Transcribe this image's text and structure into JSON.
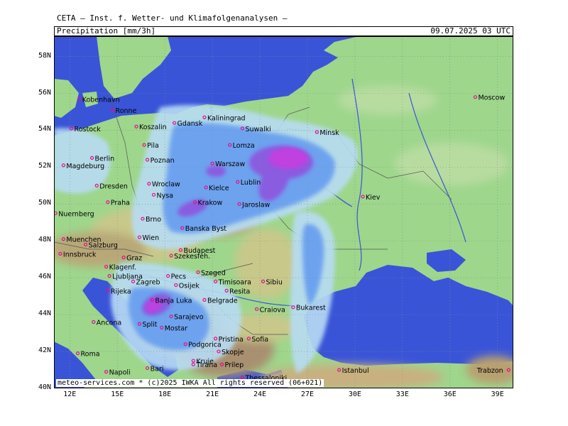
{
  "header": {
    "title": "CETA — Inst. f. Wetter- und Klimafolgenanalysen —",
    "product": "Precipitation [mm/3h]",
    "timestamp": "09.07.2025 03 UTC"
  },
  "credit": "meteo-services.com * (c)2025 IWKA All rights reserved (06+021)",
  "axes": {
    "lat_labels": [
      "58N",
      "56N",
      "54N",
      "52N",
      "50N",
      "48N",
      "46N",
      "44N",
      "42N",
      "40N"
    ],
    "lon_labels": [
      "12E",
      "15E",
      "18E",
      "21E",
      "24E",
      "27E",
      "30E",
      "33E",
      "36E",
      "39E"
    ]
  },
  "colors": {
    "sea": "#3a54d8",
    "lowland": "#9ed68c",
    "highland": "#c8c88a",
    "mountain": "#9c8a6a",
    "rain_light": "#b8dcf4",
    "rain_mid": "#6aa0f0",
    "rain_heavy": "#8a5ce0",
    "rain_extreme": "#c040e0",
    "city_marker": "#e01090",
    "grid": "#888888"
  },
  "cities": [
    {
      "name": "Kobenhavn",
      "lon": 12.6,
      "lat": 55.7
    },
    {
      "name": "Ronne",
      "lon": 14.7,
      "lat": 55.1
    },
    {
      "name": "Rostock",
      "lon": 12.1,
      "lat": 54.1
    },
    {
      "name": "Koszalin",
      "lon": 16.2,
      "lat": 54.2
    },
    {
      "name": "Gdansk",
      "lon": 18.6,
      "lat": 54.4
    },
    {
      "name": "Kaliningrad",
      "lon": 20.5,
      "lat": 54.7
    },
    {
      "name": "Suwalki",
      "lon": 22.9,
      "lat": 54.1
    },
    {
      "name": "Minsk",
      "lon": 27.6,
      "lat": 53.9
    },
    {
      "name": "Moscow",
      "lon": 37.6,
      "lat": 55.8
    },
    {
      "name": "Berlin",
      "lon": 13.4,
      "lat": 52.5
    },
    {
      "name": "Magdeburg",
      "lon": 11.6,
      "lat": 52.1
    },
    {
      "name": "Pila",
      "lon": 16.7,
      "lat": 53.2
    },
    {
      "name": "Poznan",
      "lon": 16.9,
      "lat": 52.4
    },
    {
      "name": "Lomza",
      "lon": 22.1,
      "lat": 53.2
    },
    {
      "name": "Warszaw",
      "lon": 21.0,
      "lat": 52.2
    },
    {
      "name": "Lublin",
      "lon": 22.6,
      "lat": 51.2
    },
    {
      "name": "Dresden",
      "lon": 13.7,
      "lat": 51.0
    },
    {
      "name": "Wroclaw",
      "lon": 17.0,
      "lat": 51.1
    },
    {
      "name": "Kielce",
      "lon": 20.6,
      "lat": 50.9
    },
    {
      "name": "Nysa",
      "lon": 17.3,
      "lat": 50.5
    },
    {
      "name": "Praha",
      "lon": 14.4,
      "lat": 50.1
    },
    {
      "name": "Krakow",
      "lon": 19.9,
      "lat": 50.1
    },
    {
      "name": "Jaroslaw",
      "lon": 22.7,
      "lat": 50.0
    },
    {
      "name": "Kiev",
      "lon": 30.5,
      "lat": 50.4
    },
    {
      "name": "Nuernberg",
      "lon": 11.1,
      "lat": 49.5
    },
    {
      "name": "Brno",
      "lon": 16.6,
      "lat": 49.2
    },
    {
      "name": "Banska Byst",
      "lon": 19.1,
      "lat": 48.7
    },
    {
      "name": "Muenchen",
      "lon": 11.6,
      "lat": 48.1
    },
    {
      "name": "Wien",
      "lon": 16.4,
      "lat": 48.2
    },
    {
      "name": "Salzburg",
      "lon": 13.0,
      "lat": 47.8
    },
    {
      "name": "Budapest",
      "lon": 19.0,
      "lat": 47.5
    },
    {
      "name": "Innsbruck",
      "lon": 11.4,
      "lat": 47.3
    },
    {
      "name": "Szekesfeh.",
      "lon": 18.4,
      "lat": 47.2
    },
    {
      "name": "Graz",
      "lon": 15.4,
      "lat": 47.1
    },
    {
      "name": "Klagenf.",
      "lon": 14.3,
      "lat": 46.6
    },
    {
      "name": "Szeged",
      "lon": 20.1,
      "lat": 46.3
    },
    {
      "name": "Ljubljana",
      "lon": 14.5,
      "lat": 46.1
    },
    {
      "name": "Pecs",
      "lon": 18.2,
      "lat": 46.1
    },
    {
      "name": "Rijeka",
      "lon": 14.4,
      "lat": 45.3
    },
    {
      "name": "Zagreb",
      "lon": 16.0,
      "lat": 45.8
    },
    {
      "name": "Osijek",
      "lon": 18.7,
      "lat": 45.6
    },
    {
      "name": "Timisoara",
      "lon": 21.2,
      "lat": 45.8
    },
    {
      "name": "Sibiu",
      "lon": 24.2,
      "lat": 45.8
    },
    {
      "name": "Resita",
      "lon": 21.9,
      "lat": 45.3
    },
    {
      "name": "Banja Luka",
      "lon": 17.2,
      "lat": 44.8
    },
    {
      "name": "Belgrade",
      "lon": 20.5,
      "lat": 44.8
    },
    {
      "name": "Bukarest",
      "lon": 26.1,
      "lat": 44.4
    },
    {
      "name": "Craiova",
      "lon": 23.8,
      "lat": 44.3
    },
    {
      "name": "Ancona",
      "lon": 13.5,
      "lat": 43.6
    },
    {
      "name": "Split",
      "lon": 16.4,
      "lat": 43.5
    },
    {
      "name": "Sarajevo",
      "lon": 18.4,
      "lat": 43.9
    },
    {
      "name": "Mostar",
      "lon": 17.8,
      "lat": 43.3
    },
    {
      "name": "Sofia",
      "lon": 23.3,
      "lat": 42.7
    },
    {
      "name": "Pristina",
      "lon": 21.2,
      "lat": 42.7
    },
    {
      "name": "Podgorica",
      "lon": 19.3,
      "lat": 42.4
    },
    {
      "name": "Kruje",
      "lon": 19.8,
      "lat": 41.5
    },
    {
      "name": "Skopje",
      "lon": 21.4,
      "lat": 42.0
    },
    {
      "name": "Roma",
      "lon": 12.5,
      "lat": 41.9
    },
    {
      "name": "Tirana",
      "lon": 19.8,
      "lat": 41.3
    },
    {
      "name": "Prilep",
      "lon": 21.6,
      "lat": 41.3
    },
    {
      "name": "Napoli",
      "lon": 14.3,
      "lat": 40.9
    },
    {
      "name": "Bari",
      "lon": 16.9,
      "lat": 41.1
    },
    {
      "name": "Thessaloniki",
      "lon": 22.9,
      "lat": 40.6
    },
    {
      "name": "Istanbul",
      "lon": 29.0,
      "lat": 41.0
    },
    {
      "name": "Trabzon",
      "lon": 39.7,
      "lat": 41.0
    }
  ]
}
